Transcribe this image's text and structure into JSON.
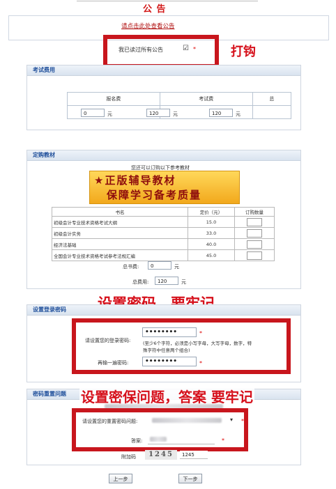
{
  "notice": {
    "title": "公 告",
    "link": "请点击此处查看公告",
    "read_label": "我已读过所有公告",
    "check_mark": "☑",
    "required": "*"
  },
  "annotations": {
    "tick": "打钩",
    "password": "设置密码，要牢记",
    "security": "设置密保问题，答案 要牢记"
  },
  "fees": {
    "header": "考试费用",
    "columns": [
      "报名费",
      "考试费",
      "总"
    ],
    "values": [
      "0",
      "120",
      "120"
    ],
    "unit": "元"
  },
  "books": {
    "header": "定购教材",
    "hint": "您还可以订购以下参考教材",
    "banner_line1": "★正版辅导教材",
    "banner_line2": "保障学习备考质量",
    "columns": [
      "书名",
      "定价（元）",
      "订购数量"
    ],
    "rows": [
      {
        "name": "初级会计专业技术资格考试大纲",
        "price": "15.0"
      },
      {
        "name": "初级会计实务",
        "price": "33.0"
      },
      {
        "name": "经济法基础",
        "price": "40.0"
      },
      {
        "name": "全国会计专业技术资格考试参考法规汇编",
        "price": "45.0"
      }
    ],
    "book_total_label": "总书费:",
    "book_total_value": "0",
    "grand_total_label": "总费用:",
    "grand_total_value": "120",
    "unit": "元"
  },
  "login": {
    "header": "设置登录密码",
    "password_label": "请设置您的登录密码:",
    "password_value": "••••••••",
    "hint_line1": "(至少6个字符，必须是小写字母，大写字母，数字，特",
    "hint_line2": "殊字符中任意两个组合)",
    "confirm_label": "再输一遍密码:",
    "confirm_value": "••••••••",
    "required": "*"
  },
  "security": {
    "header": "密码重置问题",
    "question_label": "请设置您的重置密码问题:",
    "answer_label": "答案:",
    "captcha_label": "附加码",
    "captcha_image": "1245",
    "captcha_value": "1245",
    "required": "*"
  },
  "buttons": {
    "prev": "上一步",
    "next": "下一步"
  }
}
